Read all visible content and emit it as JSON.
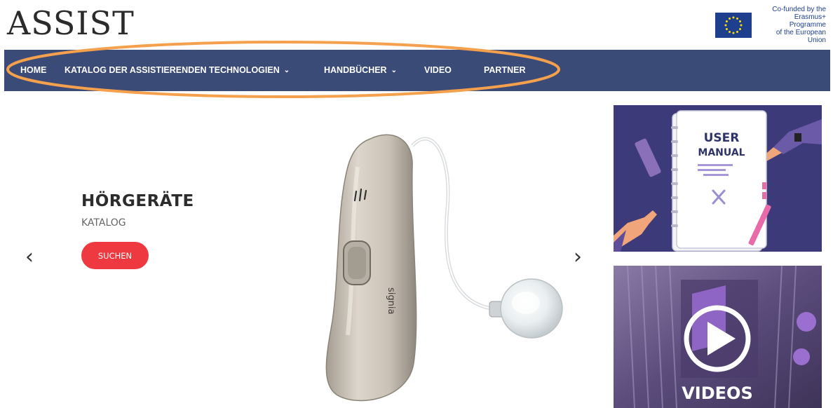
{
  "site": {
    "logo": "ASSIST"
  },
  "funding": {
    "line1": "Co-funded by the",
    "line2": "Erasmus+ Programme",
    "line3": "of the European Union"
  },
  "nav": {
    "home": "HOME",
    "catalog": "KATALOG DER ASSISTIERENDEN TECHNOLOGIEN",
    "manuals": "HANDBÜCHER",
    "video": "VIDEO",
    "partner": "PARTNER"
  },
  "slider": {
    "title": "HÖRGERÄTE",
    "subtitle": "KATALOG",
    "button": "SUCHEN",
    "product_brand": "signia",
    "prev_icon": "chevron-left-icon",
    "next_icon": "chevron-right-icon"
  },
  "cards": {
    "manual": {
      "line1": "USER",
      "line2": "MANUAL"
    },
    "video": {
      "label": "VIDEOS"
    }
  },
  "colors": {
    "nav_bg": "#3b4b77",
    "highlight": "#f4a04c",
    "button": "#ee3940",
    "eu_blue": "#1d3f8e",
    "eu_star": "#ffdd00"
  }
}
